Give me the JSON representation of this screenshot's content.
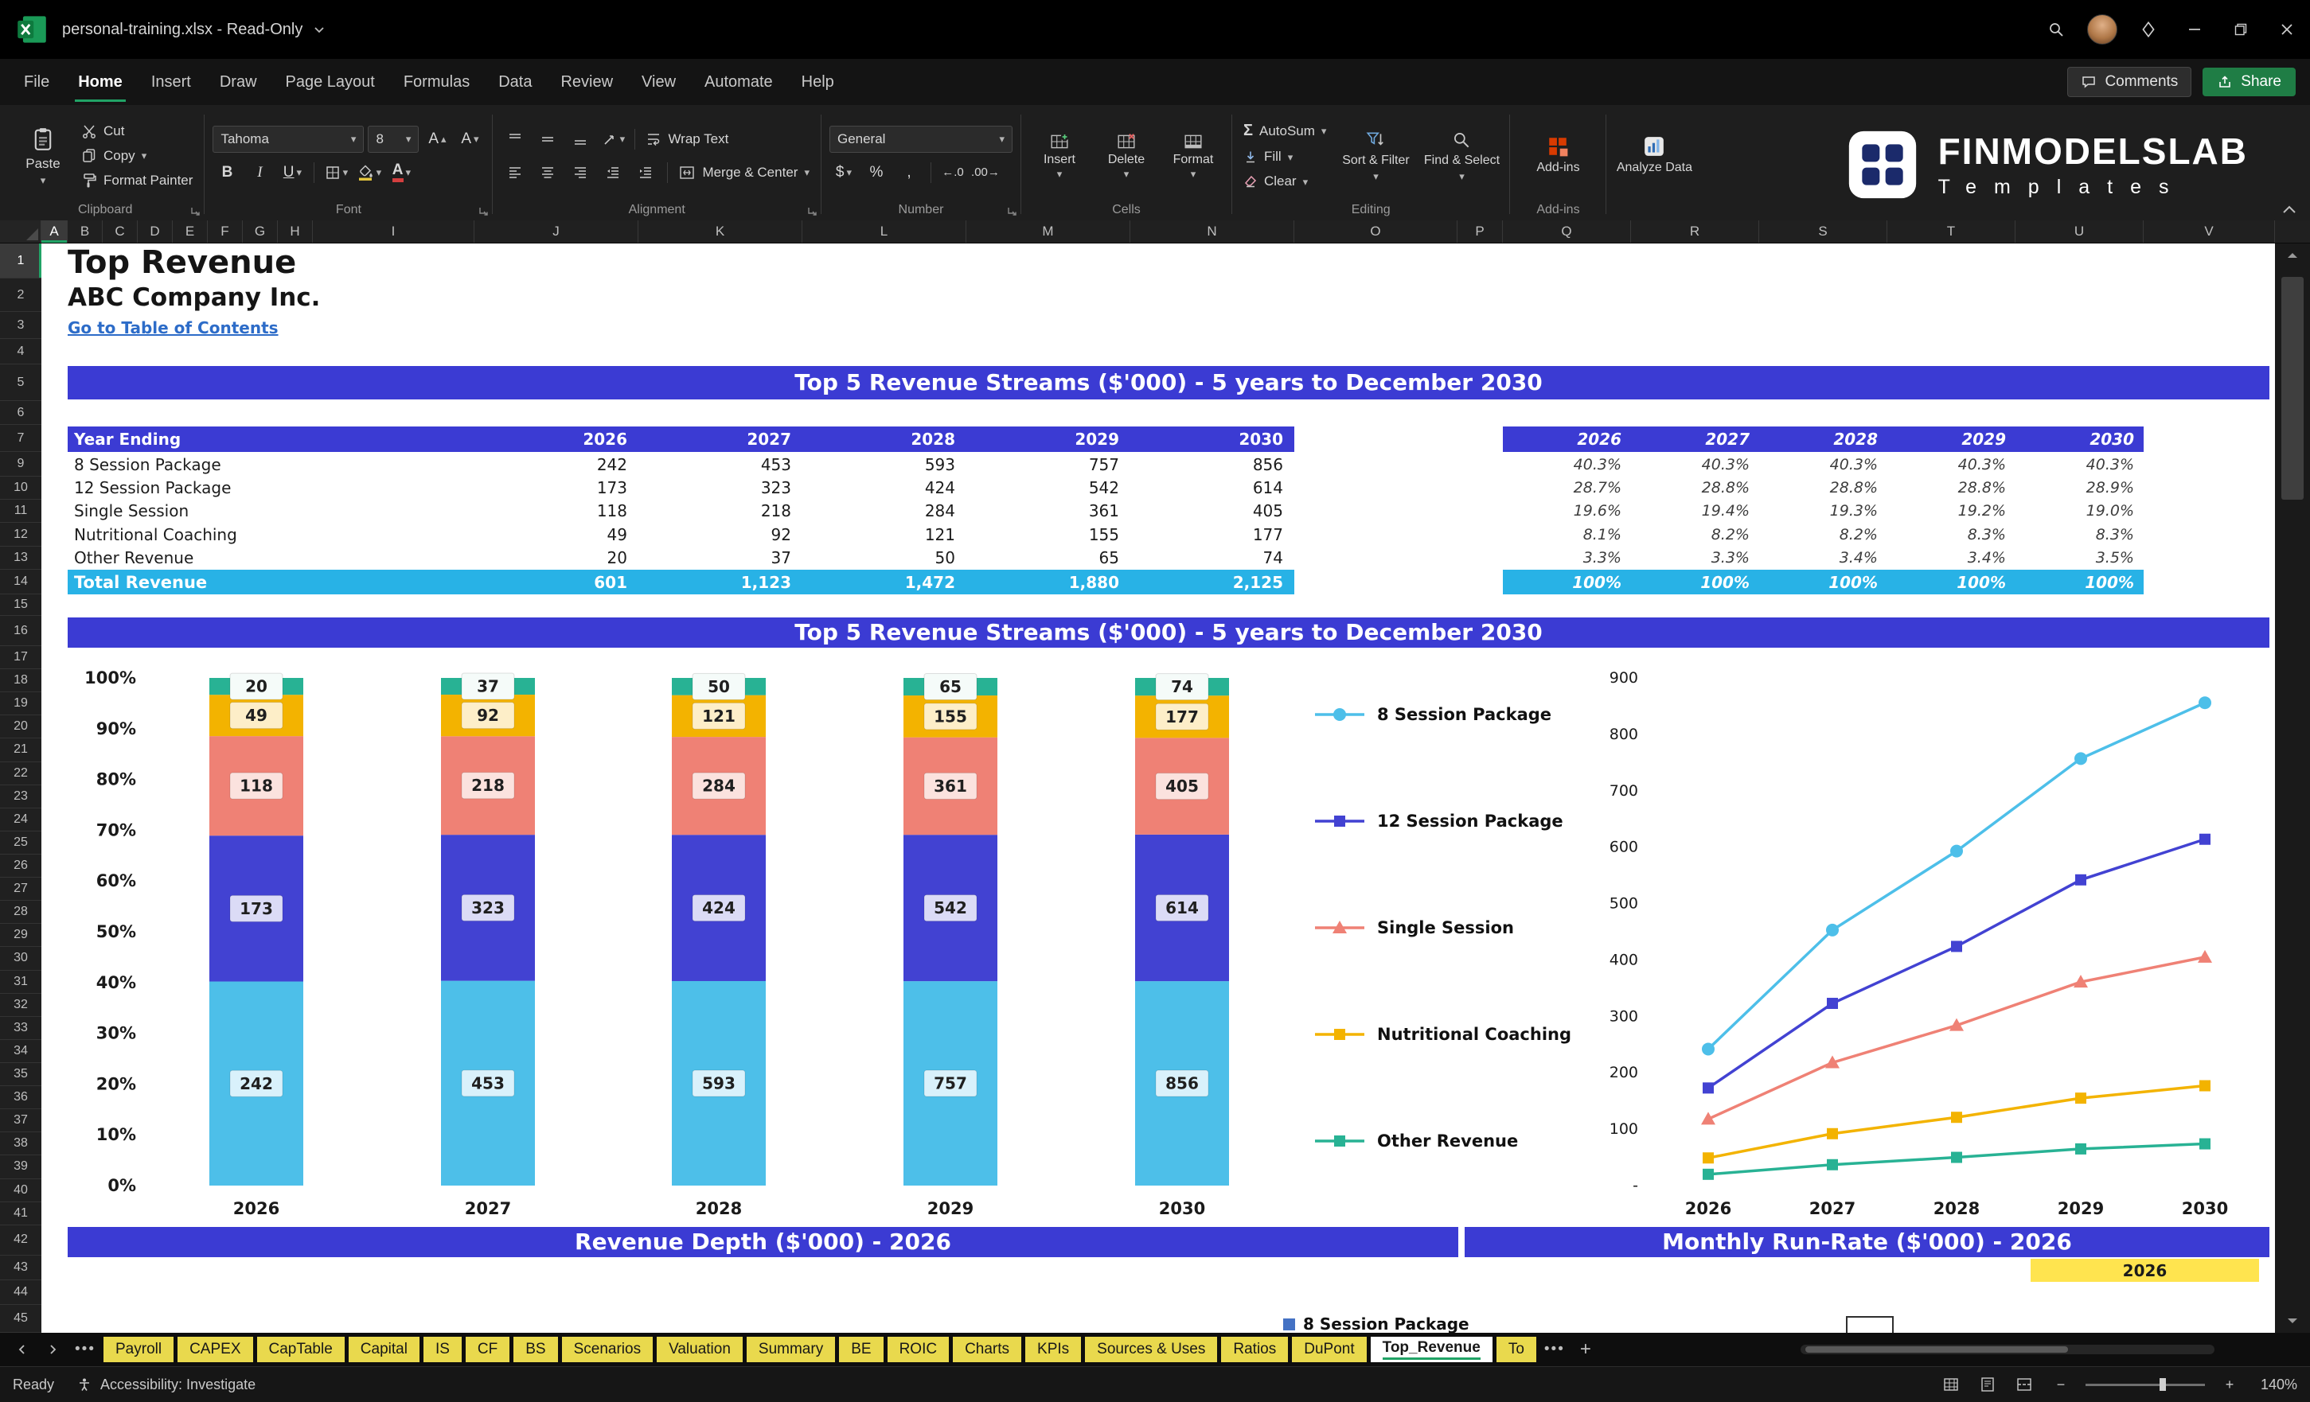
{
  "colors": {
    "banner_blue": "#3b3bd3",
    "total_cyan": "#28b2e6",
    "link_blue": "#2d6cc8",
    "tab_yellow": "#e9d94d",
    "year_cell_yellow": "#ffe44f",
    "share_green": "#1f7d45",
    "active_tab_underline": "#21a366",
    "runrate_legend_blue": "#4472c4"
  },
  "titlebar": {
    "title": "personal-training.xlsx  -  Read-Only"
  },
  "menubar": {
    "items": [
      {
        "label": "File",
        "active": false
      },
      {
        "label": "Home",
        "active": true
      },
      {
        "label": "Insert",
        "active": false
      },
      {
        "label": "Draw",
        "active": false
      },
      {
        "label": "Page Layout",
        "active": false
      },
      {
        "label": "Formulas",
        "active": false
      },
      {
        "label": "Data",
        "active": false
      },
      {
        "label": "Review",
        "active": false
      },
      {
        "label": "View",
        "active": false
      },
      {
        "label": "Automate",
        "active": false
      },
      {
        "label": "Help",
        "active": false
      }
    ],
    "comments": "Comments",
    "share": "Share"
  },
  "ribbon": {
    "paste": "Paste",
    "cut": "Cut",
    "copy": "Copy",
    "format_painter": "Format Painter",
    "clipboard_group": "Clipboard",
    "font_name": "Tahoma",
    "font_size": "8",
    "font_group": "Font",
    "wrap_text": "Wrap Text",
    "merge_center": "Merge & Center",
    "alignment_group": "Alignment",
    "number_format": "General",
    "number_group": "Number",
    "insert": "Insert",
    "delete": "Delete",
    "format": "Format",
    "cells_group": "Cells",
    "autosum": "AutoSum",
    "fill": "Fill",
    "clear": "Clear",
    "sort_filter": "Sort & Filter",
    "find_select": "Find & Select",
    "editing_group": "Editing",
    "addins": "Add-ins",
    "addins_group": "Add-ins",
    "analyze_data": "Analyze Data",
    "brand_name": "FINMODELSLAB",
    "brand_sub": "Templates"
  },
  "grid": {
    "columns": [
      "A",
      "B",
      "C",
      "D",
      "E",
      "F",
      "G",
      "H",
      "I",
      "J",
      "K",
      "L",
      "M",
      "N",
      "O",
      "P",
      "Q",
      "R",
      "S",
      "T",
      "U",
      "V"
    ],
    "visible_rows": [
      1,
      2,
      3,
      4,
      5,
      6,
      7,
      9,
      10,
      11,
      12,
      13,
      14,
      15,
      16,
      17,
      18,
      19,
      20,
      21,
      22,
      23,
      24,
      25,
      26,
      27,
      28,
      29,
      30,
      31,
      32,
      33,
      34,
      35,
      36,
      37,
      38,
      39,
      40,
      41,
      42,
      43,
      44,
      45
    ]
  },
  "sheet": {
    "title": "Top Revenue",
    "company": "ABC Company Inc.",
    "toc_link": "Go to Table of Contents",
    "banner_top": "Top 5 Revenue Streams ($'000) - 5 years to December 2030",
    "banner_chart": "Top 5 Revenue Streams ($'000) - 5 years to December 2030",
    "banner_depth": "Revenue Depth ($'000) - 2026",
    "banner_runrate": "Monthly Run-Rate ($'000) - 2026",
    "runrate_year": "2026",
    "partial_legend": "8 Session Package",
    "table": {
      "header_label": "Year Ending",
      "years": [
        "2026",
        "2027",
        "2028",
        "2029",
        "2030"
      ],
      "rows": [
        {
          "name": "8 Session Package",
          "values": [
            "242",
            "453",
            "593",
            "757",
            "856"
          ]
        },
        {
          "name": "12 Session Package",
          "values": [
            "173",
            "323",
            "424",
            "542",
            "614"
          ]
        },
        {
          "name": "Single Session",
          "values": [
            "118",
            "218",
            "284",
            "361",
            "405"
          ]
        },
        {
          "name": "Nutritional Coaching",
          "values": [
            "49",
            "92",
            "121",
            "155",
            "177"
          ]
        },
        {
          "name": "Other Revenue",
          "values": [
            "20",
            "37",
            "50",
            "65",
            "74"
          ]
        }
      ],
      "total_label": "Total Revenue",
      "total_values": [
        "601",
        "1,123",
        "1,472",
        "1,880",
        "2,125"
      ]
    },
    "pct_table": {
      "years": [
        "2026",
        "2027",
        "2028",
        "2029",
        "2030"
      ],
      "rows": [
        [
          "40.3%",
          "40.3%",
          "40.3%",
          "40.3%",
          "40.3%"
        ],
        [
          "28.7%",
          "28.8%",
          "28.8%",
          "28.8%",
          "28.9%"
        ],
        [
          "19.6%",
          "19.4%",
          "19.3%",
          "19.2%",
          "19.0%"
        ],
        [
          "8.1%",
          "8.2%",
          "8.2%",
          "8.3%",
          "8.3%"
        ],
        [
          "3.3%",
          "3.3%",
          "3.4%",
          "3.4%",
          "3.5%"
        ]
      ],
      "total_values": [
        "100%",
        "100%",
        "100%",
        "100%",
        "100%"
      ]
    }
  },
  "chart_data": [
    {
      "type": "bar",
      "stacked": "100%",
      "title": "Top 5 Revenue Streams ($'000) - 5 years to December 2030",
      "categories": [
        "2026",
        "2027",
        "2028",
        "2029",
        "2030"
      ],
      "series": [
        {
          "name": "8 Session Package",
          "color": "#4dbfe9",
          "label_bg": "#d9f1fb",
          "marker": "circle",
          "values": [
            242,
            453,
            593,
            757,
            856
          ]
        },
        {
          "name": "12 Session Package",
          "color": "#4242d2",
          "label_bg": "#dbdbf6",
          "marker": "square",
          "values": [
            173,
            323,
            424,
            542,
            614
          ]
        },
        {
          "name": "Single Session",
          "color": "#ef8175",
          "label_bg": "#fbe2de",
          "marker": "triangle",
          "values": [
            118,
            218,
            284,
            361,
            405
          ]
        },
        {
          "name": "Nutritional Coaching",
          "color": "#f3b300",
          "label_bg": "#fdeec8",
          "marker": "square",
          "values": [
            49,
            92,
            121,
            155,
            177
          ]
        },
        {
          "name": "Other Revenue",
          "color": "#28b294",
          "label_bg": "#f5fbf9",
          "marker": "square",
          "values": [
            20,
            37,
            50,
            65,
            74
          ]
        }
      ],
      "y_ticks": [
        "100%",
        "90%",
        "80%",
        "70%",
        "60%",
        "50%",
        "40%",
        "30%",
        "20%",
        "10%",
        "0%"
      ],
      "xlabel": "",
      "ylabel": "",
      "grid": false,
      "legend_position": "right"
    },
    {
      "type": "line",
      "categories": [
        "2026",
        "2027",
        "2028",
        "2029",
        "2030"
      ],
      "series": [
        {
          "name": "8 Session Package",
          "color": "#4dbfe9",
          "marker": "circle",
          "values": [
            242,
            453,
            593,
            757,
            856
          ]
        },
        {
          "name": "12 Session Package",
          "color": "#4242d2",
          "marker": "square",
          "values": [
            173,
            323,
            424,
            542,
            614
          ]
        },
        {
          "name": "Single Session",
          "color": "#ef8175",
          "marker": "triangle",
          "values": [
            118,
            218,
            284,
            361,
            405
          ]
        },
        {
          "name": "Nutritional Coaching",
          "color": "#f3b300",
          "marker": "square",
          "values": [
            49,
            92,
            121,
            155,
            177
          ]
        },
        {
          "name": "Other Revenue",
          "color": "#28b294",
          "marker": "square",
          "values": [
            20,
            37,
            50,
            65,
            74
          ]
        }
      ],
      "y_ticks": [
        "900",
        "800",
        "700",
        "600",
        "500",
        "400",
        "300",
        "200",
        "100",
        "-"
      ],
      "ylim": [
        0,
        900
      ],
      "grid": false,
      "legend_position": "none"
    }
  ],
  "tabs": {
    "items": [
      "Payroll",
      "CAPEX",
      "CapTable",
      "Capital",
      "IS",
      "CF",
      "BS",
      "Scenarios",
      "Valuation",
      "Summary",
      "BE",
      "ROIC",
      "Charts",
      "KPIs",
      "Sources & Uses",
      "Ratios",
      "DuPont",
      "Top_Revenue",
      "To"
    ],
    "active": "Top_Revenue"
  },
  "statusbar": {
    "ready": "Ready",
    "accessibility": "Accessibility: Investigate",
    "zoom": "140%"
  }
}
